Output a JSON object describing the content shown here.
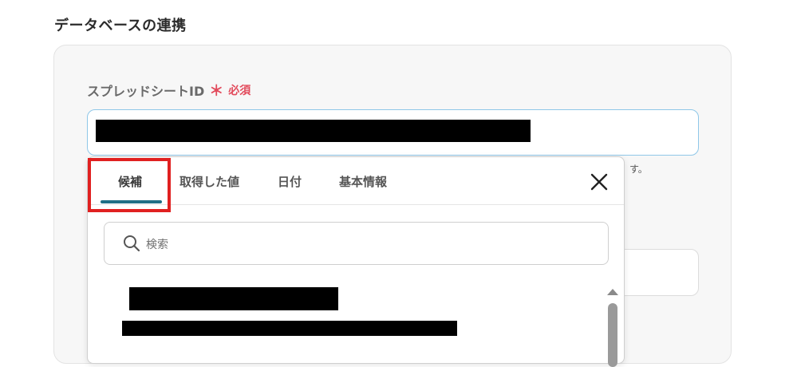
{
  "section": {
    "title": "データベースの連携"
  },
  "field": {
    "label": "スプレッドシートID",
    "required_mark": "＊",
    "required_text": "必須",
    "hint_tail": "す。"
  },
  "popup": {
    "tabs": [
      {
        "label": "候補",
        "active": true
      },
      {
        "label": "取得した値",
        "active": false
      },
      {
        "label": "日付",
        "active": false
      },
      {
        "label": "基本情報",
        "active": false
      }
    ],
    "close_icon": "close-icon",
    "search": {
      "placeholder": "検索",
      "icon": "search-icon"
    }
  },
  "colors": {
    "accent": "#1f6f86",
    "required": "#e24b5c",
    "highlight": "#e02020",
    "input_focus_border": "#8fc7e8"
  }
}
